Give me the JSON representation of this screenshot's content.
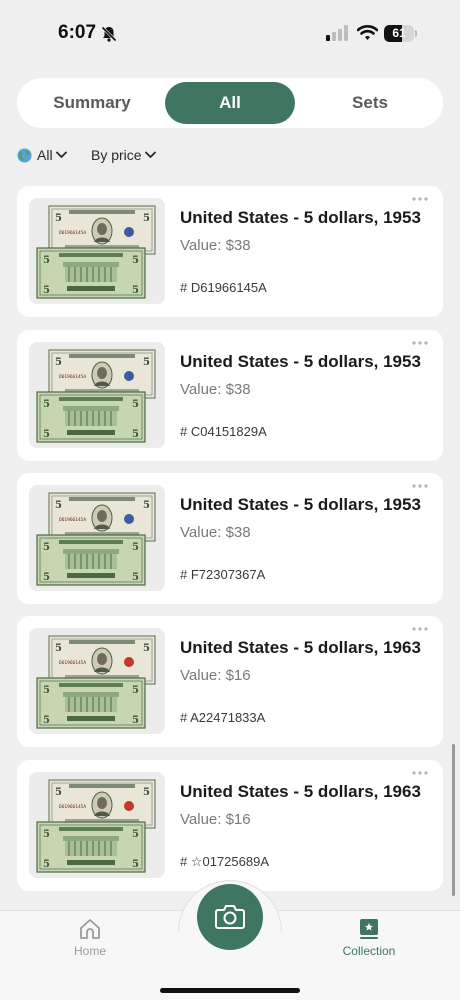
{
  "status_bar": {
    "time": "6:07",
    "battery": 61,
    "icons": [
      "bell-slash-icon",
      "signal-icon",
      "wifi-icon",
      "battery-icon"
    ]
  },
  "tabs": [
    {
      "label": "Summary",
      "active": false
    },
    {
      "label": "All",
      "active": true
    },
    {
      "label": "Sets",
      "active": false
    }
  ],
  "filters": {
    "region_label": "All",
    "region_icon": "globe-icon",
    "sort_label": "By price"
  },
  "items": [
    {
      "title": "United States - 5 dollars, 1953",
      "value": "Value: $38",
      "serial": "# D61966145A",
      "seal_color": "#3c5aa6"
    },
    {
      "title": "United States - 5 dollars, 1953",
      "value": "Value: $38",
      "serial": "# C04151829A",
      "seal_color": "#3c5aa6"
    },
    {
      "title": "United States - 5 dollars, 1953",
      "value": "Value: $38",
      "serial": "# F72307367A",
      "seal_color": "#3c5aa6"
    },
    {
      "title": "United States - 5 dollars, 1963",
      "value": "Value: $16",
      "serial": "# A22471833A",
      "seal_color": "#c0392b"
    },
    {
      "title": "United States - 5 dollars, 1963",
      "value": "Value: $16",
      "serial": "# ☆01725689A",
      "seal_color": "#c0392b"
    }
  ],
  "bottom_nav": {
    "home_label": "Home",
    "collection_label": "Collection",
    "camera_icon": "camera-icon"
  },
  "colors": {
    "accent": "#3e7662",
    "background": "#efefef",
    "card": "#ffffff"
  }
}
